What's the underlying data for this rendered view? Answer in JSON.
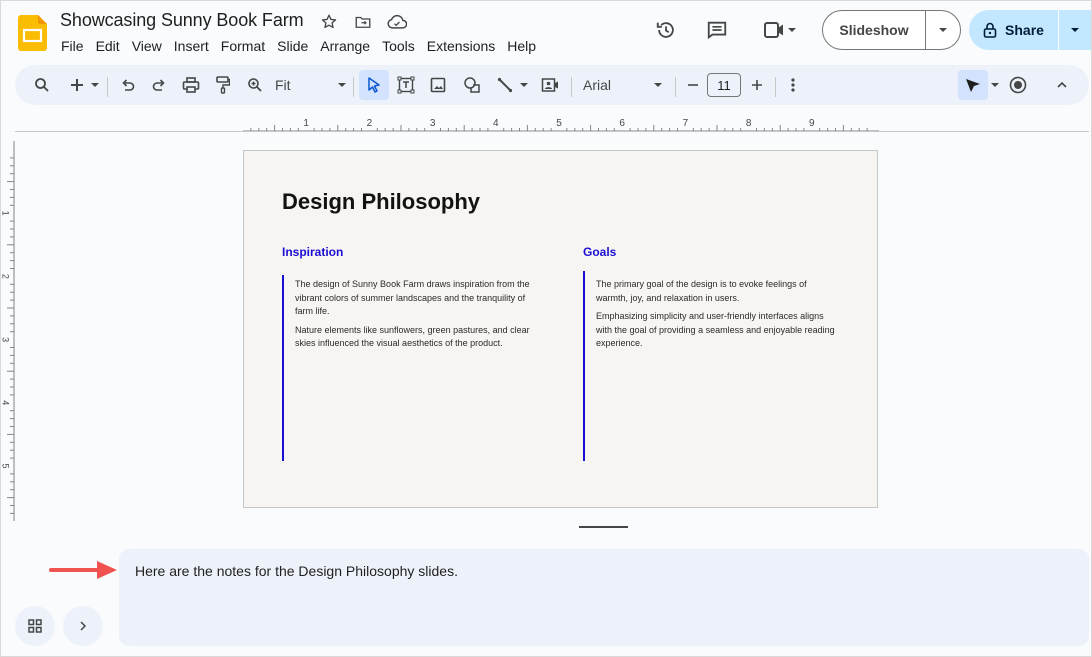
{
  "app": {
    "doc_title": "Showcasing Sunny Book Farm",
    "title_icons": [
      "star-icon",
      "move-to-folder-icon",
      "cloud-saved-icon"
    ]
  },
  "menu": [
    "File",
    "Edit",
    "View",
    "Insert",
    "Format",
    "Slide",
    "Arrange",
    "Tools",
    "Extensions",
    "Help"
  ],
  "header_actions": {
    "slideshow_label": "Slideshow",
    "share_label": "Share"
  },
  "toolbar": {
    "zoom_value": "Fit",
    "font_name": "Arial",
    "font_size": "11"
  },
  "rulers": {
    "horizontal_labels": [
      "1",
      "2",
      "3",
      "4",
      "5",
      "6",
      "7",
      "8",
      "9"
    ],
    "vertical_labels": [
      "1",
      "2",
      "3",
      "4",
      "5"
    ]
  },
  "slide": {
    "title": "Design Philosophy",
    "accent_color": "#1a0dd4",
    "background_color": "#f7f5f2",
    "columns": [
      {
        "heading": "Inspiration",
        "paragraphs": [
          "The design of Sunny Book Farm draws inspiration from the vibrant colors of summer landscapes and the tranquility of farm life.",
          "Nature elements like sunflowers, green pastures, and clear skies influenced the visual aesthetics of the product."
        ]
      },
      {
        "heading": "Goals",
        "paragraphs": [
          "The primary goal of the design is to evoke feelings of warmth, joy, and relaxation in users.",
          "Emphasizing simplicity and user-friendly interfaces aligns with the goal of providing a seamless and enjoyable reading experience."
        ]
      }
    ]
  },
  "notes": {
    "text": "Here are the notes for the Design Philosophy slides.",
    "annotation_arrow_color": "#f0524f"
  }
}
